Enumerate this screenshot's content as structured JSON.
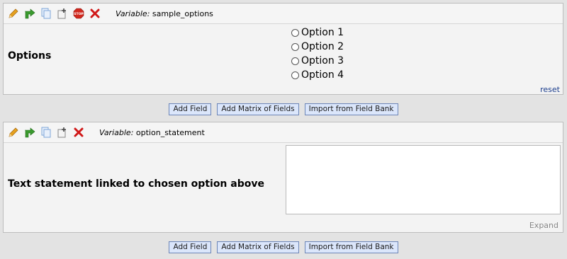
{
  "field1": {
    "variable_prefix": "Variable:",
    "variable_name": "sample_options",
    "label": "Options",
    "options": [
      "Option 1",
      "Option 2",
      "Option 3",
      "Option 4"
    ],
    "reset_label": "reset",
    "icons": [
      "pencil-icon",
      "branching-arrow-icon",
      "copy-icon",
      "move-icon",
      "stop-icon",
      "delete-icon"
    ]
  },
  "buttons1": {
    "add_field": "Add Field",
    "add_matrix": "Add Matrix of Fields",
    "import_bank": "Import from Field Bank"
  },
  "field2": {
    "variable_prefix": "Variable:",
    "variable_name": "option_statement",
    "label": "Text statement linked to chosen option above",
    "expand_label": "Expand",
    "icons": [
      "pencil-icon",
      "branching-arrow-icon",
      "copy-icon",
      "move-icon",
      "delete-icon"
    ]
  },
  "buttons2": {
    "add_field": "Add Field",
    "add_matrix": "Add Matrix of Fields",
    "import_bank": "Import from Field Bank"
  },
  "colors": {
    "pencil": "#e6a21f",
    "branch": "#3a9a2e",
    "copy": "#7ea6d8",
    "stop": "#d1281e",
    "delete": "#d01818",
    "link": "#1a3c8c",
    "button_bg": "#dbe6fb"
  }
}
